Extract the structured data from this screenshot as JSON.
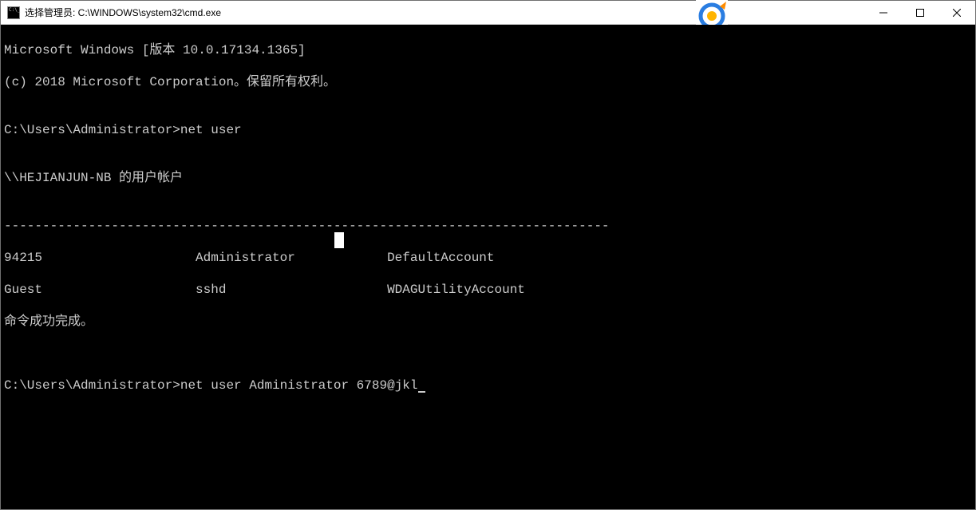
{
  "window": {
    "title": "选择管理员: C:\\WINDOWS\\system32\\cmd.exe"
  },
  "console": {
    "line1": "Microsoft Windows [版本 10.0.17134.1365]",
    "line2": "(c) 2018 Microsoft Corporation。保留所有权利。",
    "blank1": "",
    "prompt1": "C:\\Users\\Administrator>net user",
    "blank2": "",
    "userHeader": "\\\\HEJIANJUN-NB 的用户帐户",
    "blank3": "",
    "divider": "-------------------------------------------------------------------------------",
    "row1": "94215                    Administrator            DefaultAccount",
    "row2": "Guest                    sshd                     WDAGUtilityAccount",
    "done": "命令成功完成。",
    "blank4": "",
    "blank5": "",
    "prompt2_prefix": "C:\\Users\\Administrator>",
    "prompt2_cmd": "net user Administrator 6789@jkl"
  },
  "icons": {
    "minimize": "minimize",
    "maximize": "maximize",
    "close": "close"
  }
}
